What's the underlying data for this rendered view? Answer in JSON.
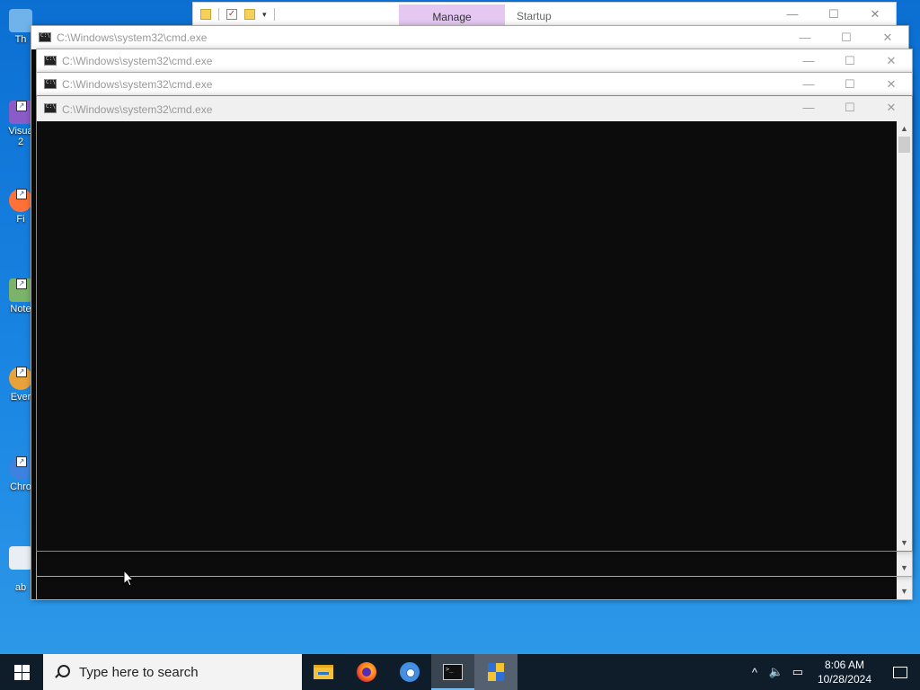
{
  "desktop": {
    "icons": [
      {
        "label": "Th",
        "color": "#6fb3ea"
      },
      {
        "label": "Visua",
        "label2": "2",
        "color": "#8a5cc7"
      },
      {
        "label": "Fi",
        "color": "#ff7139"
      },
      {
        "label": "Note",
        "color": "#7bb36a"
      },
      {
        "label": "Ever",
        "color": "#e8a23a"
      },
      {
        "label": "Chro",
        "color": "#3d82e0"
      },
      {
        "label": "ab",
        "color": "#e9eef5"
      }
    ]
  },
  "explorer": {
    "tab_manage": "Manage",
    "tab_startup": "Startup",
    "minimize": "—",
    "maximize": "☐",
    "close": "✕"
  },
  "cmd_windows": [
    {
      "title": "C:\\Windows\\system32\\cmd.exe"
    },
    {
      "title": "C:\\Windows\\system32\\cmd.exe"
    },
    {
      "title": "C:\\Windows\\system32\\cmd.exe"
    },
    {
      "title": "C:\\Windows\\system32\\cmd.exe"
    }
  ],
  "window_controls": {
    "minimize": "—",
    "maximize": "☐",
    "close": "✕"
  },
  "scrollbar": {
    "up": "▲",
    "down": "▼"
  },
  "taskbar": {
    "search_placeholder": "Type here to search",
    "apps": [
      "file-explorer",
      "firefox",
      "chrome",
      "command-prompt",
      "security-shield"
    ],
    "tray": {
      "chevron": "^",
      "volume": "🔈",
      "network": "▭"
    },
    "time": "8:06 AM",
    "date": "10/28/2024"
  },
  "colors": {
    "desktop": "#1b86e3",
    "taskbar": "#0f1d2b",
    "console": "#0c0c0c",
    "manage_tab": "#e4c8f2"
  }
}
